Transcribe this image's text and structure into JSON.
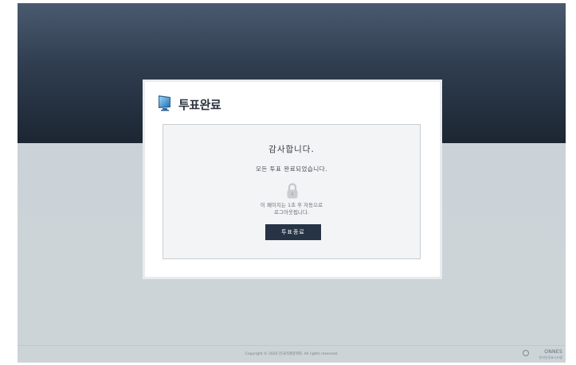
{
  "dialog": {
    "title": "투표완료",
    "thanks": "감사합니다.",
    "completed_message": "모든 투표 완료되었습니다.",
    "logout_line1": "이 페이지는 1초 후 자동으로",
    "logout_line2": "로그아웃됩니다.",
    "end_button_label": "투표종료",
    "title_icon": "monitor-icon",
    "status_icon": "lock-icon"
  },
  "footer": {
    "copyright": "Copyright © 2020 한국미래정책회. All rights reserved.",
    "brand_name": "ONNES",
    "brand_sub": "온라인투표시스템"
  },
  "colors": {
    "header_dark": "#1c2633",
    "header_light": "#4a5a6e",
    "page_background": "#cdd4d8",
    "button_background": "#263445",
    "inner_box_background": "#f3f4f5"
  }
}
